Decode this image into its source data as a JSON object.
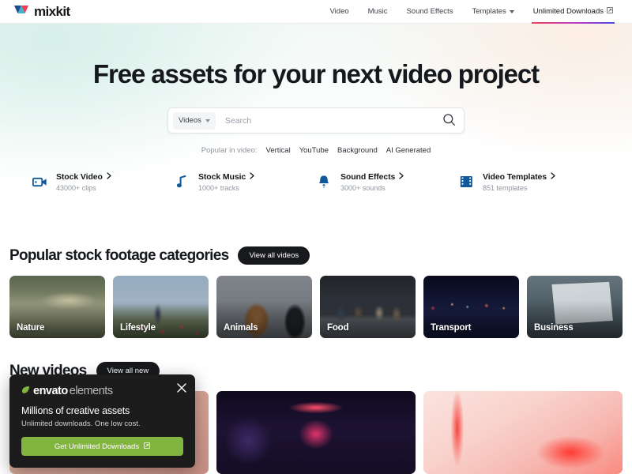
{
  "header": {
    "logo_text": "mixkit",
    "logo_icon": "mixkit-triangles-icon",
    "nav": [
      {
        "label": "Video",
        "icon": null,
        "active": false
      },
      {
        "label": "Music",
        "icon": null,
        "active": false
      },
      {
        "label": "Sound Effects",
        "icon": null,
        "active": false
      },
      {
        "label": "Templates",
        "icon": "chevron-down-icon",
        "active": false
      },
      {
        "label": "Unlimited Downloads",
        "icon": "external-link-icon",
        "active": true
      }
    ]
  },
  "hero": {
    "title": "Free assets for your next video project",
    "search": {
      "type_label": "Videos",
      "placeholder": "Search",
      "value": "",
      "search_icon": "search-icon"
    },
    "popular": {
      "label": "Popular in video:",
      "links": [
        "Vertical",
        "YouTube",
        "Background",
        "AI Generated"
      ]
    },
    "shortcuts": [
      {
        "title": "Stock Video",
        "sub": "43000+ clips",
        "icon": "video-camera-icon"
      },
      {
        "title": "Stock Music",
        "sub": "1000+ tracks",
        "icon": "music-note-icon"
      },
      {
        "title": "Sound Effects",
        "sub": "3000+ sounds",
        "icon": "bell-icon"
      },
      {
        "title": "Video Templates",
        "sub": "851 templates",
        "icon": "film-strip-icon"
      }
    ]
  },
  "categories_section": {
    "title": "Popular stock footage categories",
    "cta_label": "View all videos",
    "cards": [
      {
        "label": "Nature"
      },
      {
        "label": "Lifestyle"
      },
      {
        "label": "Animals"
      },
      {
        "label": "Food"
      },
      {
        "label": "Transport"
      },
      {
        "label": "Business"
      }
    ]
  },
  "new_videos_section": {
    "title": "New videos",
    "cta_label": "View all new"
  },
  "popup": {
    "brand_strong": "envato",
    "brand_light": "elements",
    "headline": "Millions of creative assets",
    "subtext": "Unlimited downloads. One low cost.",
    "button_label": "Get Unlimited Downloads",
    "button_icon": "external-link-icon",
    "close_icon": "close-icon",
    "brand_color": "#82b440"
  },
  "colors": {
    "accent_blue": "#12599c",
    "dark": "#17191c",
    "green": "#82b440"
  }
}
